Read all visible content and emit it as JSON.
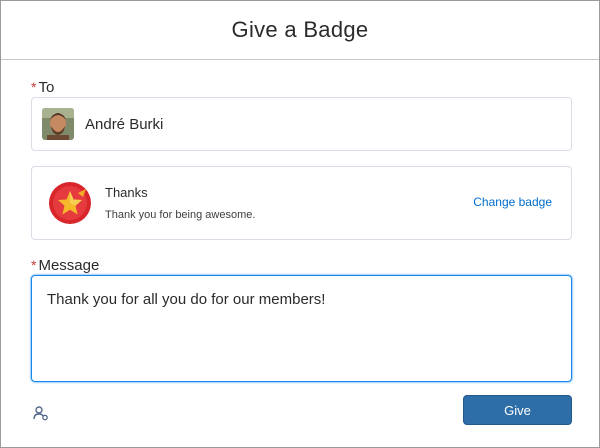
{
  "dialog": {
    "title": "Give a Badge"
  },
  "to": {
    "label": "To",
    "required_marker": "*",
    "recipient_name": "André Burki"
  },
  "badge": {
    "title": "Thanks",
    "description": "Thank you for being awesome.",
    "change_label": "Change badge",
    "icon": "star-badge-icon",
    "colors": {
      "ring": "#d8262b",
      "star": "#f5b82a"
    }
  },
  "message": {
    "label": "Message",
    "required_marker": "*",
    "value": "Thank you for all you do for our members!"
  },
  "footer": {
    "give_label": "Give",
    "icon": "user-settings-icon"
  },
  "colors": {
    "accent": "#1589ee",
    "button": "#2e6ea8",
    "link": "#006dcc",
    "required": "#c23934"
  }
}
